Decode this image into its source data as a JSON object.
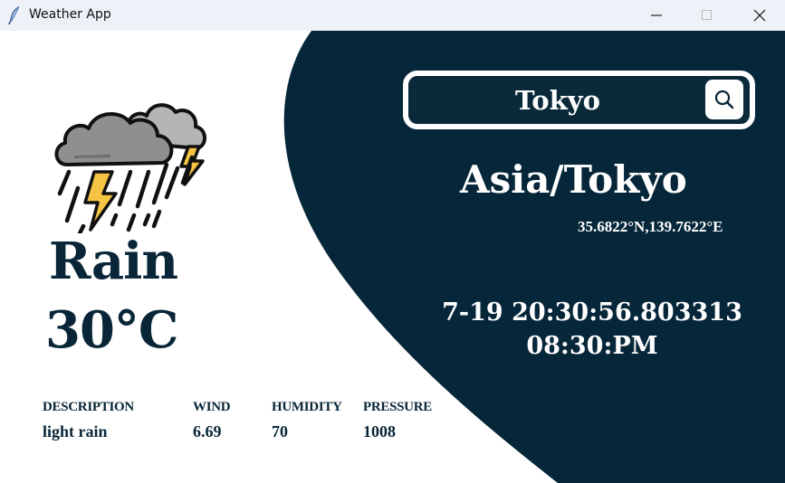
{
  "window": {
    "title": "Weather App",
    "icon": "feather-icon",
    "controls": [
      "minimize-icon",
      "maximize-icon",
      "close-icon"
    ]
  },
  "colors": {
    "panel": "#06263a",
    "text_dark": "#082637",
    "text_light": "#ffffff",
    "titlebar": "#eef1f8"
  },
  "search": {
    "value": "Tokyo",
    "button_icon": "search-icon"
  },
  "location": {
    "timezone": "Asia/Tokyo",
    "coordinates": "35.6822°N,139.7622°E"
  },
  "time": {
    "datetime": "7-19 20:30:56.803313",
    "clock": "08:30:PM"
  },
  "weather": {
    "icon": "thunderstorm-cloud-icon",
    "condition": "Rain",
    "temperature": "30°C"
  },
  "stats": {
    "labels": [
      "DESCRIPTION",
      "WIND",
      "HUMIDITY",
      "PRESSURE"
    ],
    "values": [
      "light rain",
      "6.69",
      "70",
      "1008"
    ]
  }
}
